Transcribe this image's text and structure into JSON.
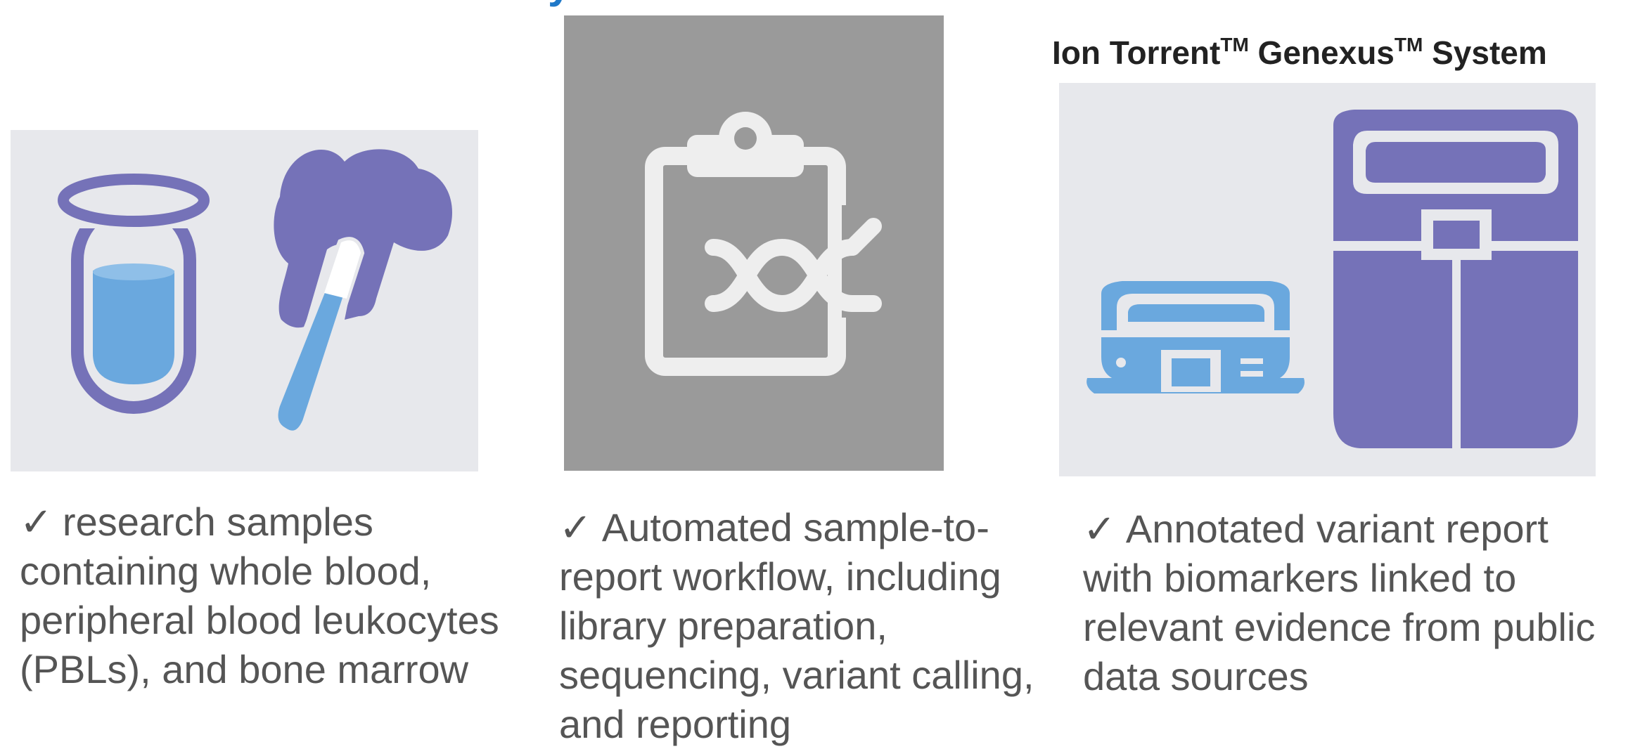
{
  "heading_fragments": [
    "Ion Torrent",
    "Genexus",
    "System"
  ],
  "system_title": {
    "part1": "Ion Torrent",
    "tm1": "TM",
    "part2": " Genexus",
    "tm2": "TM",
    "part3": " System"
  },
  "captions": [
    {
      "check": "✓",
      "text": "research samples containing whole blood, peripheral blood leukocytes (PBLs), and bone marrow"
    },
    {
      "check": "✓",
      "text": "Automated sample-to-report workflow, including library preparation, sequencing, variant calling, and reporting"
    },
    {
      "check": "✓",
      "text": "Annotated variant report with biomarkers linked to relevant evidence from public data sources"
    }
  ],
  "icons": [
    "test-tube-icon",
    "bone-marrow-icon",
    "clipboard-dna-icon",
    "genexus-purifier-icon",
    "genexus-integrated-sequencer-icon"
  ],
  "colors": {
    "heading_blue": "#1f78c8",
    "icon_purple": "#7572b8",
    "icon_blue": "#6aa8de",
    "panel_light": "#e7e8ec",
    "panel_gray": "#9a9a9a",
    "caption_text": "#555555"
  }
}
